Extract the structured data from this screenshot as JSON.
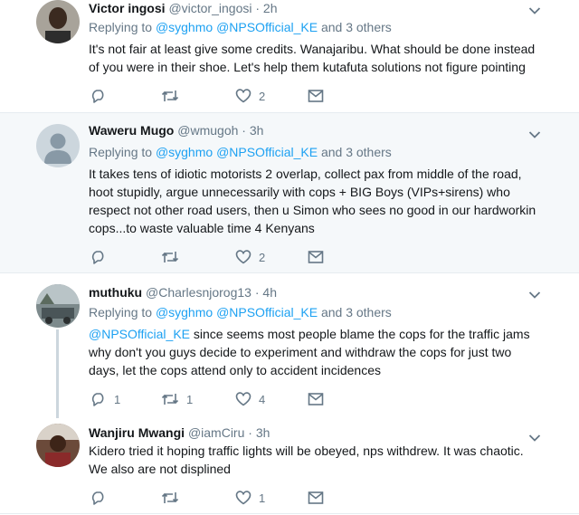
{
  "tweets": [
    {
      "name": "Victor ingosi",
      "handle": "@victor_ingosi",
      "dot": "·",
      "time": "2h",
      "reply_prefix": "Replying to",
      "mentions": [
        "@syghmo",
        "@NPSOfficial_KE"
      ],
      "reply_suffix": "and 3 others",
      "lines": [
        "It's not fair at least give some credits. Wanajaribu. What should be done instead",
        "of you were in their shoe. Let's help them kutafuta solutions not figure pointing"
      ],
      "counts": {
        "replies": "",
        "retweets": "",
        "likes": "2"
      }
    },
    {
      "name": "Waweru Mugo",
      "handle": "@wmugoh",
      "dot": "·",
      "time": "3h",
      "reply_prefix": "Replying to",
      "mentions": [
        "@syghmo",
        "@NPSOfficial_KE"
      ],
      "reply_suffix": "and 3 others",
      "lines": [
        "It takes tens of idiotic motorists 2 overlap, collect pax from middle of the road,",
        "hoot stupidly, argue unnecessarily with cops + BIG Boys (VIPs+sirens) who",
        "respect not other road users, then u Simon who sees no good in our hardworkin",
        "cops...to waste valuable time 4 Kenyans"
      ],
      "counts": {
        "replies": "",
        "retweets": "",
        "likes": "2"
      }
    },
    {
      "name": "muthuku",
      "handle": "@Charlesnjorog13",
      "dot": "·",
      "time": "4h",
      "reply_prefix": "Replying to",
      "mentions": [
        "@syghmo",
        "@NPSOfficial_KE"
      ],
      "reply_suffix": "and 3 others",
      "first_mention": "@NPSOfficial_KE",
      "lines": [
        " since seems most people blame the cops for the traffic jams",
        "why don't you guys decide to experiment and withdraw the cops for just two",
        "days, let the cops attend only to accident incidences"
      ],
      "counts": {
        "replies": "1",
        "retweets": "1",
        "likes": "4"
      }
    },
    {
      "name": "Wanjiru Mwangi",
      "handle": "@iamCiru",
      "dot": "·",
      "time": "3h",
      "lines": [
        "Kidero tried it hoping traffic lights will be obeyed, nps withdrew. It was chaotic.",
        "We also are not displined"
      ],
      "counts": {
        "replies": "",
        "retweets": "",
        "likes": "1"
      }
    }
  ],
  "colors": {
    "accent": "#1da1f2",
    "muted": "#657786",
    "text": "#14171a",
    "highlight_bg": "#f5f8fa",
    "divider": "#e6ecf0"
  },
  "icons": [
    "reply-icon",
    "retweet-icon",
    "like-icon",
    "direct-message-icon",
    "chevron-down-icon"
  ]
}
